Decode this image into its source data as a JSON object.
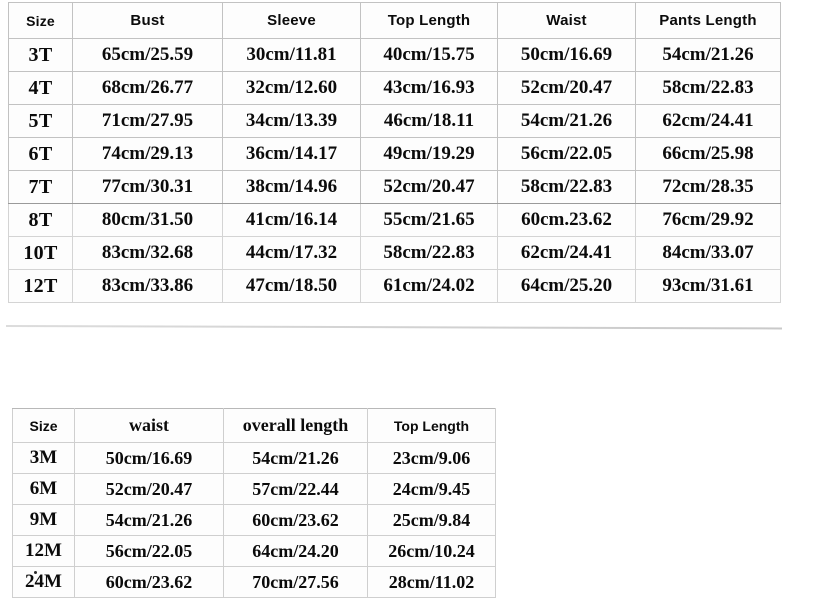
{
  "document": {
    "kind": "apparel-size-chart",
    "background_color": "#ffffff",
    "text_color": "#0b0b0b",
    "border_color": "#d4d4d4"
  },
  "tables": [
    {
      "id": "toddler",
      "name": "toddler-size-chart",
      "columns": [
        "Size",
        "Bust",
        "Sleeve",
        "Top Length",
        "Waist",
        "Pants Length"
      ],
      "rows": [
        {
          "size": "3T",
          "bust": "65cm/25.59",
          "sleeve": "30cm/11.81",
          "top_length": "40cm/15.75",
          "waist": "50cm/16.69",
          "pants_length": "54cm/21.26"
        },
        {
          "size": "4T",
          "bust": "68cm/26.77",
          "sleeve": "32cm/12.60",
          "top_length": "43cm/16.93",
          "waist": "52cm/20.47",
          "pants_length": "58cm/22.83"
        },
        {
          "size": "5T",
          "bust": "71cm/27.95",
          "sleeve": "34cm/13.39",
          "top_length": "46cm/18.11",
          "waist": "54cm/21.26",
          "pants_length": "62cm/24.41"
        },
        {
          "size": "6T",
          "bust": "74cm/29.13",
          "sleeve": "36cm/14.17",
          "top_length": "49cm/19.29",
          "waist": "56cm/22.05",
          "pants_length": "66cm/25.98"
        },
        {
          "size": "7T",
          "bust": "77cm/30.31",
          "sleeve": "38cm/14.96",
          "top_length": "52cm/20.47",
          "waist": "58cm/22.83",
          "pants_length": "72cm/28.35"
        },
        {
          "size": "8T",
          "bust": "80cm/31.50",
          "sleeve": "41cm/16.14",
          "top_length": "55cm/21.65",
          "waist": "60cm.23.62",
          "pants_length": "76cm/29.92"
        },
        {
          "size": "10T",
          "bust": "83cm/32.68",
          "sleeve": "44cm/17.32",
          "top_length": "58cm/22.83",
          "waist": "62cm/24.41",
          "pants_length": "84cm/33.07"
        },
        {
          "size": "12T",
          "bust": "83cm/33.86",
          "sleeve": "47cm/18.50",
          "top_length": "61cm/24.02",
          "waist": "64cm/25.20",
          "pants_length": "93cm/31.61"
        }
      ]
    },
    {
      "id": "baby",
      "name": "baby-size-chart",
      "columns": [
        "Size",
        "waist",
        "overall length",
        "Top Length"
      ],
      "rows": [
        {
          "size": "3M",
          "waist": "50cm/16.69",
          "overall_length": "54cm/21.26",
          "top_length": "23cm/9.06"
        },
        {
          "size": "6M",
          "waist": "52cm/20.47",
          "overall_length": "57cm/22.44",
          "top_length": "24cm/9.45"
        },
        {
          "size": "9M",
          "waist": "54cm/21.26",
          "overall_length": "60cm/23.62",
          "top_length": "25cm/9.84"
        },
        {
          "size": "12M",
          "waist": "56cm/22.05",
          "overall_length": "64cm/24.20",
          "top_length": "26cm/10.24"
        },
        {
          "size": "24M",
          "waist": "60cm/23.62",
          "overall_length": "70cm/27.56",
          "top_length": "28cm/11.02"
        }
      ]
    }
  ]
}
